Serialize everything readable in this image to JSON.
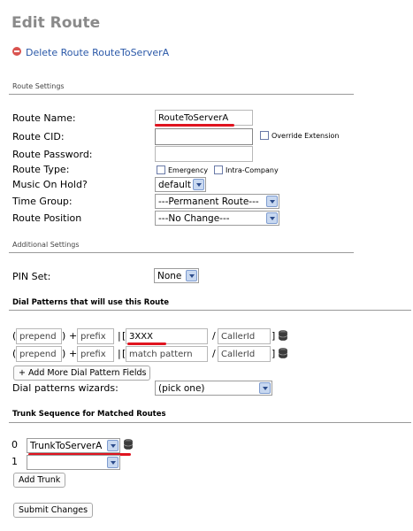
{
  "page": {
    "title": "Edit Route"
  },
  "actions": {
    "delete_link": "Delete Route RouteToServerA"
  },
  "route_settings": {
    "section_label": "Route Settings",
    "route_name": {
      "label": "Route Name:",
      "value": "RouteToServerA"
    },
    "route_cid": {
      "label": "Route CID:",
      "value": "",
      "override_label": "Override Extension",
      "override_checked": false
    },
    "route_password": {
      "label": "Route Password:",
      "value": ""
    },
    "route_type": {
      "label": "Route Type:",
      "emergency_label": "Emergency",
      "intra_company_label": "Intra-Company",
      "emergency_checked": false,
      "intra_company_checked": false
    },
    "music_on_hold": {
      "label": "Music On Hold?",
      "selected": "default"
    },
    "time_group": {
      "label": "Time Group:",
      "selected": "---Permanent Route---"
    },
    "route_position": {
      "label": "Route Position",
      "selected": "---No Change---"
    }
  },
  "additional_settings": {
    "section_label": "Additional Settings",
    "pin_set": {
      "label": "PIN Set:",
      "selected": "None"
    }
  },
  "dial_patterns": {
    "section_label": "Dial Patterns that will use this Route",
    "rows": [
      {
        "prepend": "prepend",
        "prefix": "prefix",
        "match_pattern": "3XXX",
        "caller_id": "CallerId"
      },
      {
        "prepend": "prepend",
        "prefix": "prefix",
        "match_pattern": "match pattern",
        "caller_id": "CallerId"
      }
    ],
    "symbols": {
      "open_paren": "(",
      "close_paren": ")",
      "plus": "+",
      "pipe": "|",
      "bracket_open": "[",
      "slash": "/",
      "bracket_close": "]"
    },
    "add_more_label": "+ Add More Dial Pattern Fields",
    "wizards": {
      "label": "Dial patterns wizards:",
      "selected": "(pick one)"
    }
  },
  "trunk_sequence": {
    "section_label": "Trunk Sequence for Matched Routes",
    "rows": [
      {
        "index": "0",
        "selected": "TrunkToServerA"
      },
      {
        "index": "1",
        "selected": ""
      }
    ],
    "add_trunk_label": "Add Trunk"
  },
  "submit_label": "Submit Changes",
  "colors": {
    "annotation_red": "#e0141f",
    "link_blue": "#2a58a8",
    "title_gray": "#8a8a8a"
  }
}
